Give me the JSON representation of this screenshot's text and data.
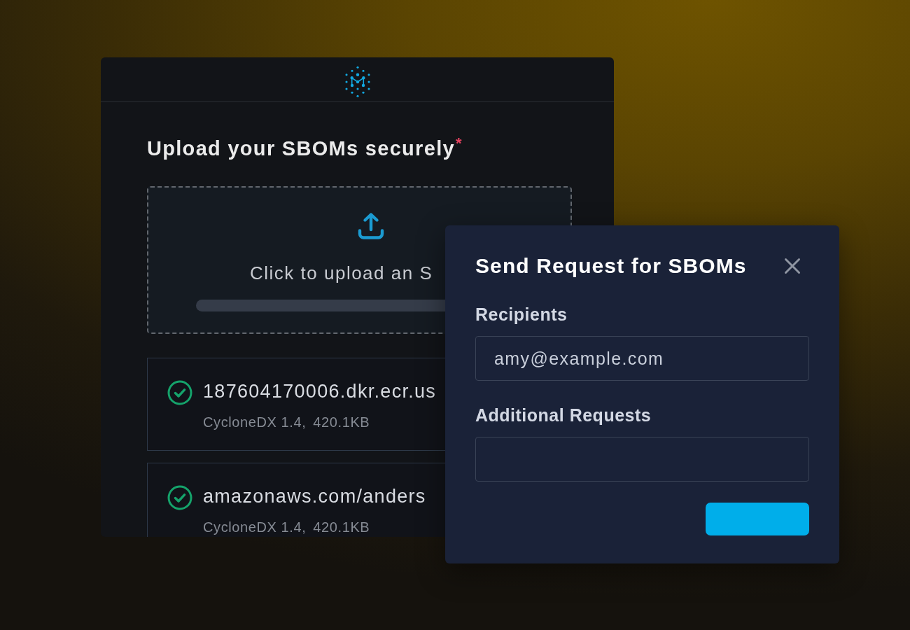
{
  "upload_panel": {
    "heading": "Upload your SBOMs securely",
    "required_mark": "*",
    "dropzone": {
      "prompt": "Click to upload an S"
    },
    "files": [
      {
        "name": "187604170006.dkr.ecr.us",
        "format": "CycloneDX 1.4,",
        "size": "420.1KB",
        "uploaded": true
      },
      {
        "name": "amazonaws.com/anders",
        "format": "CycloneDX 1.4,",
        "size": "420.1KB",
        "uploaded": true
      }
    ]
  },
  "dialog": {
    "title": "Send Request for SBOMs",
    "fields": [
      {
        "label": "Recipients",
        "value": "amy@example.com"
      },
      {
        "label": "Additional Requests"
      }
    ]
  }
}
